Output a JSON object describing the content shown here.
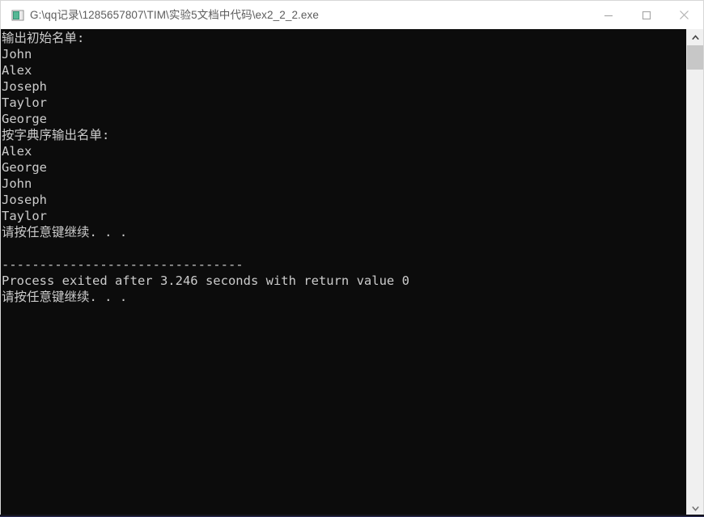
{
  "window": {
    "title": "G:\\qq记录\\1285657807\\TIM\\实验5文档中代码\\ex2_2_2.exe",
    "icon": "console-window-icon",
    "titlebar_bg": "#ffffff",
    "titlebar_text_color": "#5d5d5d",
    "console_bg": "#0c0c0c",
    "console_text_color": "#cccccc"
  },
  "controls": {
    "minimize_label": "—",
    "maximize_label": "☐",
    "close_label": "✕",
    "minimize_name": "minimize",
    "maximize_name": "maximize",
    "close_name": "close"
  },
  "console": {
    "lines": [
      "输出初始名单:",
      "John",
      "Alex",
      "Joseph",
      "Taylor",
      "George",
      "按字典序输出名单:",
      "Alex",
      "George",
      "John",
      "Joseph",
      "Taylor",
      "请按任意键继续. . .",
      "",
      "--------------------------------",
      "Process exited after 3.246 seconds with return value 0",
      "请按任意键继续. . ."
    ],
    "text": "输出初始名单:\nJohn\nAlex\nJoseph\nTaylor\nGeorge\n按字典序输出名单:\nAlex\nGeorge\nJohn\nJoseph\nTaylor\n请按任意键继续. . .\n\n--------------------------------\nProcess exited after 3.246 seconds with return value 0\n请按任意键继续. . .",
    "program_output": {
      "initial_list_header": "输出初始名单:",
      "initial_list": [
        "John",
        "Alex",
        "Joseph",
        "Taylor",
        "George"
      ],
      "sorted_list_header": "按字典序输出名单:",
      "sorted_list": [
        "Alex",
        "George",
        "John",
        "Joseph",
        "Taylor"
      ],
      "press_any_key": "请按任意键继续. . .",
      "separator": "--------------------------------",
      "exit_message": "Process exited after 3.246 seconds with return value 0",
      "exit_seconds": "3.246",
      "return_value": "0"
    }
  },
  "scrollbar": {
    "up_arrow": "⌃",
    "down_arrow": "⌄"
  }
}
